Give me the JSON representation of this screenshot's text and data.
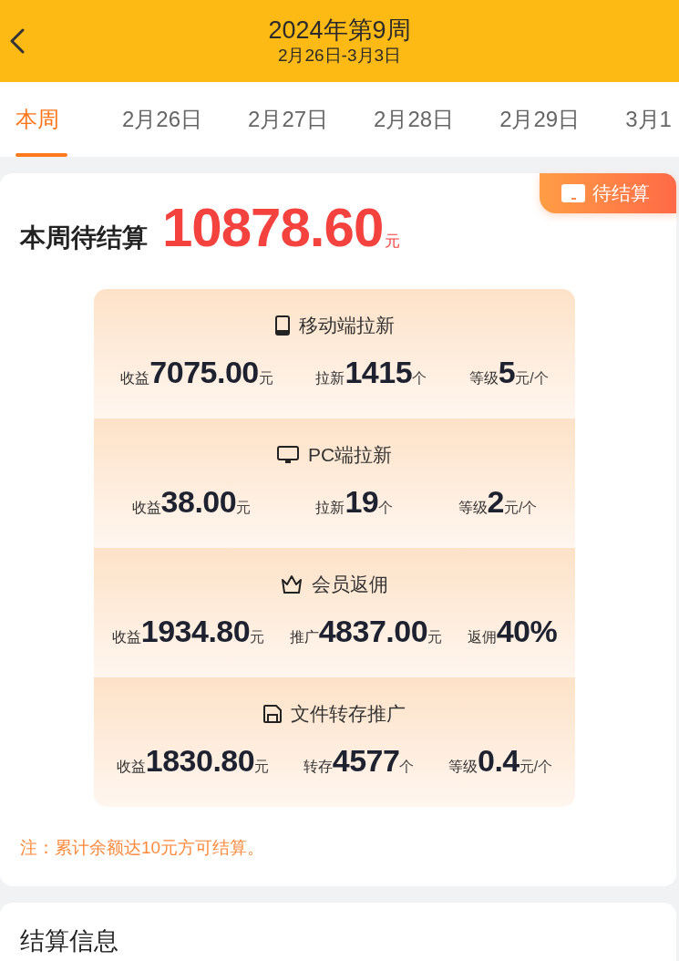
{
  "header": {
    "title": "2024年第9周",
    "subtitle": "2月26日-3月3日"
  },
  "tabs": [
    {
      "label": "本周",
      "selected": true
    },
    {
      "label": "2月26日",
      "selected": false
    },
    {
      "label": "2月27日",
      "selected": false
    },
    {
      "label": "2月28日",
      "selected": false
    },
    {
      "label": "2月29日",
      "selected": false
    },
    {
      "label": "3月1",
      "selected": false
    }
  ],
  "summary": {
    "badge": "待结算",
    "title": "本周待结算",
    "amount": "10878.60",
    "unit": "元"
  },
  "categories": [
    {
      "kind": "mobile",
      "title": "移动端拉新",
      "stats": [
        {
          "label": "收益",
          "value": "7075.00",
          "unit": "元"
        },
        {
          "label": "拉新",
          "value": "1415",
          "unit": "个"
        },
        {
          "label": "等级",
          "value": "5",
          "unit": "元/个"
        }
      ]
    },
    {
      "kind": "pc",
      "title": "PC端拉新",
      "stats": [
        {
          "label": "收益",
          "value": "38.00",
          "unit": "元"
        },
        {
          "label": "拉新",
          "value": "19",
          "unit": "个"
        },
        {
          "label": "等级",
          "value": "2",
          "unit": "元/个"
        }
      ]
    },
    {
      "kind": "vip",
      "title": "会员返佣",
      "stats": [
        {
          "label": "收益",
          "value": "1934.80",
          "unit": "元"
        },
        {
          "label": "推广",
          "value": "4837.00",
          "unit": "元"
        },
        {
          "label": "返佣",
          "value": "40%"
        }
      ]
    },
    {
      "kind": "file",
      "title": "文件转存推广",
      "stats": [
        {
          "label": "收益",
          "value": "1830.80",
          "unit": "元"
        },
        {
          "label": "转存",
          "value": "4577",
          "unit": "个"
        },
        {
          "label": "等级",
          "value": "0.4",
          "unit": "元/个"
        }
      ]
    }
  ],
  "note": "注：累计余额达10元方可结算。",
  "settlement": {
    "title": "结算信息"
  }
}
